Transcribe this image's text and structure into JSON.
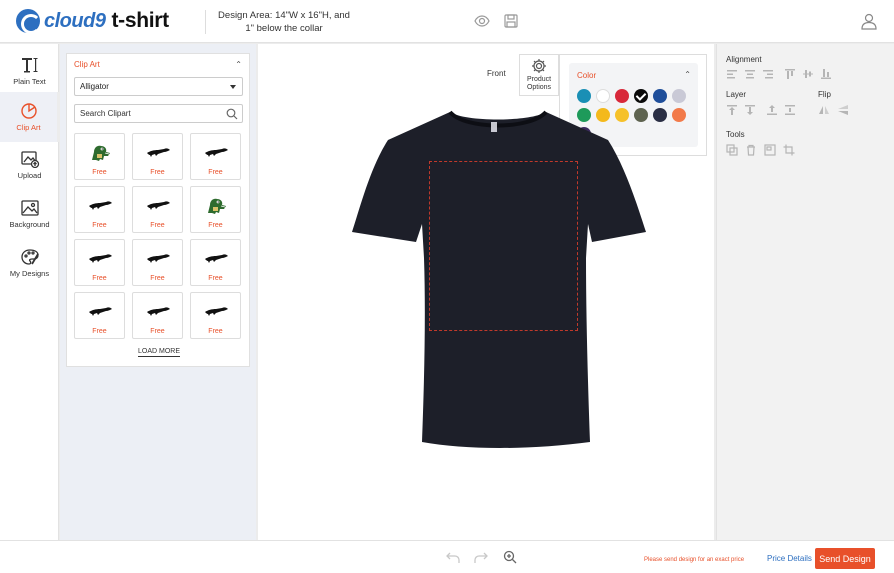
{
  "header": {
    "logo_left": "cloud9",
    "logo_right": "t-shirt",
    "design_area_line1": "Design Area: 14\"W x 16\"H, and",
    "design_area_line2": "1\" below the collar",
    "icons": [
      "eye-icon",
      "save-icon",
      "user-icon"
    ]
  },
  "leftnav": {
    "items": [
      {
        "label": "Plain Text",
        "icon": "text-icon"
      },
      {
        "label": "Clip Art",
        "icon": "clipart-icon",
        "active": true
      },
      {
        "label": "Upload",
        "icon": "upload-icon"
      },
      {
        "label": "Background",
        "icon": "background-icon"
      },
      {
        "label": "My Designs",
        "icon": "palette-icon"
      }
    ]
  },
  "clipart": {
    "title": "Clip Art",
    "category": "Alligator",
    "search_placeholder": "Search Clipart",
    "items": [
      {
        "price": "Free",
        "art": "gator-cartoon"
      },
      {
        "price": "Free",
        "art": "gator-silhouette"
      },
      {
        "price": "Free",
        "art": "gator-silhouette"
      },
      {
        "price": "Free",
        "art": "gator-silhouette"
      },
      {
        "price": "Free",
        "art": "gator-silhouette"
      },
      {
        "price": "Free",
        "art": "gator-cartoon"
      },
      {
        "price": "Free",
        "art": "gator-silhouette"
      },
      {
        "price": "Free",
        "art": "gator-silhouette"
      },
      {
        "price": "Free",
        "art": "gator-silhouette"
      },
      {
        "price": "Free",
        "art": "gator-silhouette"
      },
      {
        "price": "Free",
        "art": "gator-silhouette"
      },
      {
        "price": "Free",
        "art": "gator-silhouette"
      }
    ],
    "load_more": "LOAD MORE"
  },
  "canvas": {
    "view_label": "Front",
    "product_options_line1": "Product",
    "product_options_line2": "Options",
    "shirt_color": "#1d1f29",
    "color_panel": {
      "title": "Color",
      "swatches": [
        "#1a8fb5",
        "#ffffff",
        "#d8283a",
        "#0b0b0b",
        "#1f4e9a",
        "#c9c9d6",
        "#1e9a5a",
        "#f4b91c",
        "#f6c12a",
        "#5e6350",
        "#2a2e44",
        "#f27a4a",
        "#3b2a5e"
      ],
      "selected_index": 3
    }
  },
  "rightpanel": {
    "alignment_label": "Alignment",
    "layer_label": "Layer",
    "flip_label": "Flip",
    "tools_label": "Tools"
  },
  "footer": {
    "note": "Please send design for an exact price",
    "price_details": "Price Details",
    "send_design": "Send Design"
  }
}
